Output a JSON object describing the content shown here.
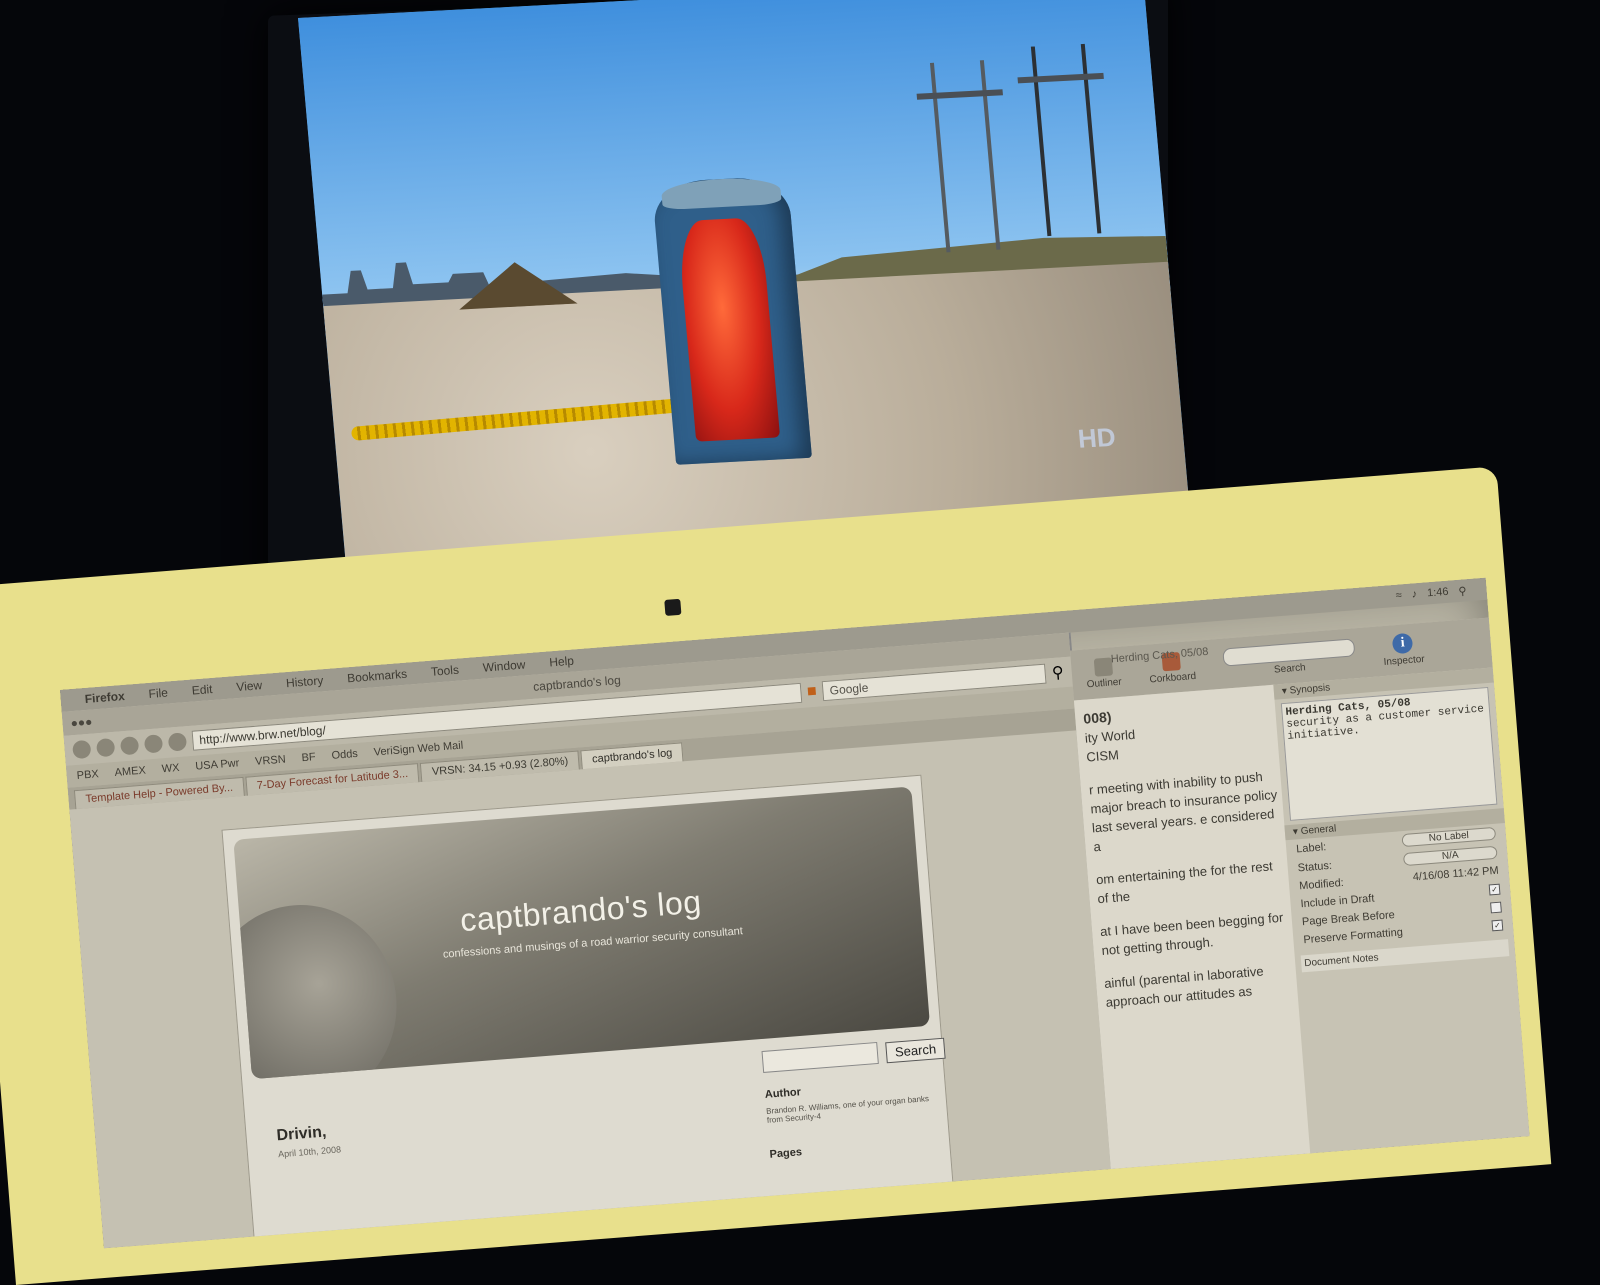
{
  "tv": {
    "bug": "HD"
  },
  "menubar": {
    "items": [
      "Firefox",
      "File",
      "Edit",
      "View",
      "History",
      "Bookmarks",
      "Tools",
      "Window",
      "Help"
    ],
    "status": [
      "1:46"
    ]
  },
  "browser": {
    "window_title": "captbrando's log",
    "url": "http://www.brw.net/blog/",
    "search_placeholder": "Google",
    "bookmarks": [
      "PBX",
      "AMEX",
      "WX",
      "USA Pwr",
      "VRSN",
      "BF",
      "Odds",
      "VeriSign Web Mail"
    ],
    "tabs": [
      {
        "label": "7-Day Forecast for Latitude 3...",
        "active": false
      },
      {
        "label": "VRSN: 34.15 +0.93 (2.80%)",
        "active": false,
        "ticker": true
      },
      {
        "label": "captbrando's log",
        "active": true
      }
    ],
    "secondary_tab": "Template Help - Powered By..."
  },
  "blog": {
    "title": "captbrando's log",
    "tagline": "confessions and musings of a road warrior security consultant",
    "search_button": "Search",
    "post_title": "Drivin,",
    "post_date": "April 10th, 2008",
    "author_heading": "Author",
    "author_bio": "Brandon R. Williams, one of your organ banks from Security-4",
    "pages_heading": "Pages"
  },
  "editor": {
    "doc_title": "Herding Cats, 05/08",
    "toolbar": {
      "outliner": "Outliner",
      "corkboard": "Corkboard",
      "search": "Search",
      "inspector": "Inspector"
    },
    "body": {
      "heading": "008)",
      "lines": [
        "ity World",
        "CISM"
      ],
      "para1": "r meeting with inability to push major breach to insurance policy last several years. e considered a",
      "para2": "om entertaining the for the rest of the",
      "para3": "at I have been been begging for not getting through.",
      "para4": "ainful (parental in laborative approach our attitudes as"
    },
    "inspector": {
      "synopsis_label": "Synopsis",
      "synopsis_title": "Herding Cats, 05/08",
      "synopsis_text": "security as a customer service initiative.",
      "general_label": "General",
      "label_field": "Label:",
      "label_value": "No Label",
      "status_field": "Status:",
      "status_value": "N/A",
      "modified_field": "Modified:",
      "modified_value": "4/16/08 11:42 PM",
      "include_draft": "Include in Draft",
      "page_break": "Page Break Before",
      "preserve_formatting": "Preserve Formatting",
      "doc_notes": "Document Notes"
    }
  }
}
